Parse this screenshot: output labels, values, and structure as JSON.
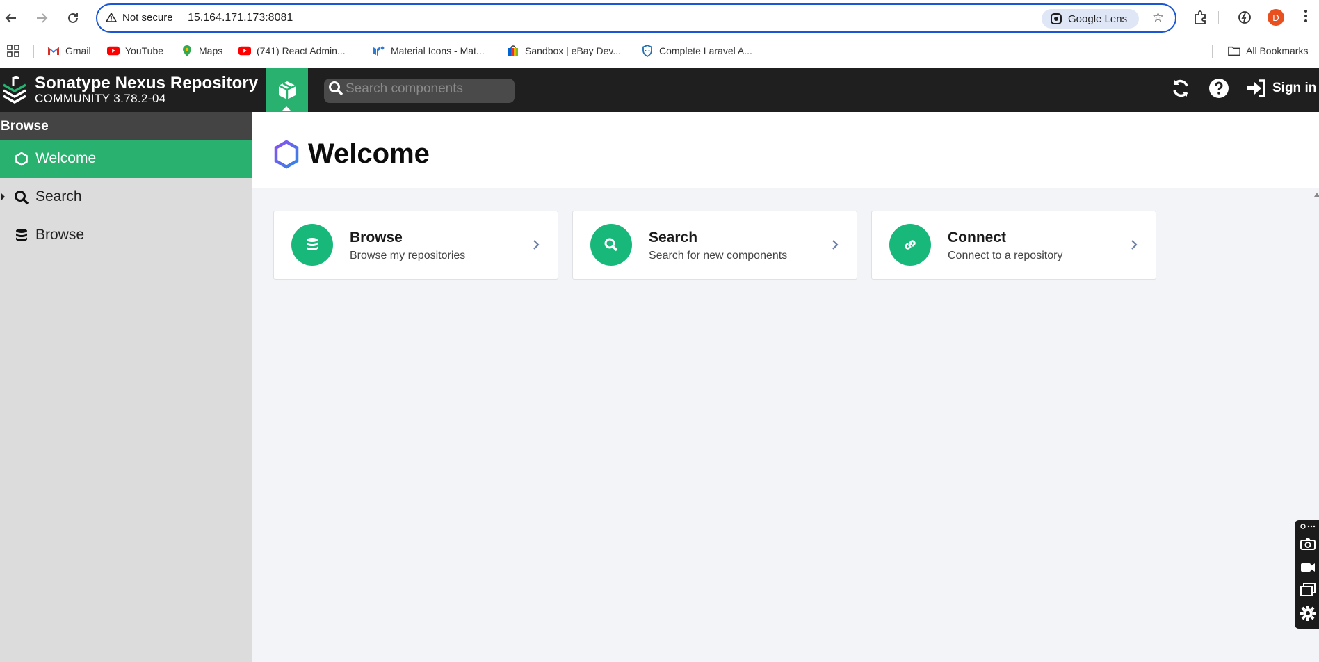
{
  "browser": {
    "security_label": "Not secure",
    "url": "15.164.171.173:8081",
    "lens_label": "Google Lens",
    "profile_initial": "D",
    "bookmarks": [
      {
        "label": "Gmail",
        "icon": "gmail-icon"
      },
      {
        "label": "YouTube",
        "icon": "youtube-icon"
      },
      {
        "label": "Maps",
        "icon": "maps-icon"
      },
      {
        "label": "(741) React Admin...",
        "icon": "youtube-icon"
      },
      {
        "label": "Material Icons - Mat...",
        "icon": "material-icon"
      },
      {
        "label": "Sandbox | eBay Dev...",
        "icon": "ebay-icon"
      },
      {
        "label": "Complete Laravel A...",
        "icon": "shield-icon"
      }
    ],
    "all_bookmarks_label": "All Bookmarks"
  },
  "app": {
    "name": "Sonatype Nexus Repository",
    "edition": "COMMUNITY 3.78.2-04",
    "search_placeholder": "Search components",
    "sign_in_label": "Sign in",
    "brand_color": "#29b16f"
  },
  "sidebar": {
    "header": "Browse",
    "items": [
      {
        "label": "Welcome",
        "icon": "hexagon-icon",
        "active": true
      },
      {
        "label": "Search",
        "icon": "search-icon",
        "active": false
      },
      {
        "label": "Browse",
        "icon": "database-icon",
        "active": false
      }
    ]
  },
  "main": {
    "title": "Welcome",
    "cards": [
      {
        "title": "Browse",
        "description": "Browse my repositories",
        "icon": "database-icon"
      },
      {
        "title": "Search",
        "description": "Search for new components",
        "icon": "search-icon"
      },
      {
        "title": "Connect",
        "description": "Connect to a repository",
        "icon": "link-icon"
      }
    ]
  }
}
